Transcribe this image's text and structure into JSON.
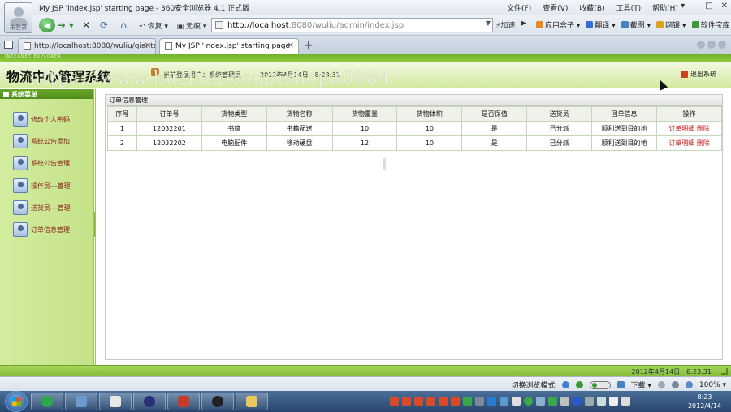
{
  "browser": {
    "window_title": "My JSP 'index.jsp' starting page - 360安全浏览器 4.1 正式版",
    "avatar_label": "未登录",
    "menus": [
      "文件(F)",
      "查看(V)",
      "收藏(B)",
      "工具(T)",
      "帮助(H)"
    ],
    "controls": {
      "minimize": "–",
      "maximize": "□",
      "close": "✕",
      "extra": "▾"
    },
    "nav": {
      "back": "◀",
      "forward": "➜ ▾",
      "stop": "✕",
      "refresh": "⟳",
      "home": "⌂",
      "restore_label": "↶ 恢复 ▾",
      "noimage_label": "▣ 无痕 ▾"
    },
    "address": {
      "host": "http://localhost",
      "path": ":8080/wuliu/admin/index.jsp",
      "dropdown": "▼"
    },
    "accelerate_label": "⚡加速",
    "go_label": "▶",
    "toolbar_right": [
      "应用盒子 ▾",
      "翻译 ▾",
      "截图 ▾",
      "网银 ▾",
      "软件宝库"
    ],
    "tabs": [
      {
        "label": "http://localhost:8080/wuliu/qiantai/...",
        "close": "✕"
      },
      {
        "label": "My JSP 'index.jsp' starting page",
        "close": "✕"
      }
    ],
    "newtab": "+",
    "status_right": {
      "mode_label": "切换浏览模式",
      "download_label": "下载 ▾",
      "zoom": "100% ▾"
    }
  },
  "app": {
    "brand_line": "INTERNET EXPLORER",
    "system_title": "物流中心管理系统",
    "watermark": "https://www.huzhan.com/ishop30884",
    "user_label": "当前登录用户：系统管理员",
    "header_time": "2012年4月14日　8:23:31",
    "logout_label": "退出系统",
    "menu_title": "系统菜单",
    "menu_items": [
      "修改个人密码",
      "系统公告添加",
      "系统公告管理",
      "操作员---管理",
      "送货员---管理",
      "订单信息管理"
    ],
    "panel_title": "订单信息管理",
    "table": {
      "headers": [
        "序号",
        "订单号",
        "货物类型",
        "货物名称",
        "货物重量",
        "货物体积",
        "是否保值",
        "送货员",
        "回单信息",
        "操作"
      ],
      "rows": [
        {
          "no": "1",
          "order": "12032201",
          "type": "书籍",
          "name": "书籍配送",
          "weight": "10",
          "volume": "10",
          "insured": "是",
          "courier": "已分派",
          "receipt": "顺利送到目的地",
          "op_detail": "订单明细",
          "op_delete": "删除"
        },
        {
          "no": "2",
          "order": "12032202",
          "type": "电脑配件",
          "name": "移动硬盘",
          "weight": "12",
          "volume": "10",
          "insured": "是",
          "courier": "已分派",
          "receipt": "顺利送到目的地",
          "op_detail": "订单明细",
          "op_delete": "删除"
        }
      ]
    },
    "footer_time": "2012年4月14日　8:23:31"
  },
  "taskbar": {
    "time": "8:23",
    "date": "2012/4/14"
  },
  "colors": {
    "accent_green": "#8fcb3c",
    "link_red": "#c81e1e",
    "menu_bg": "#c4e288"
  }
}
